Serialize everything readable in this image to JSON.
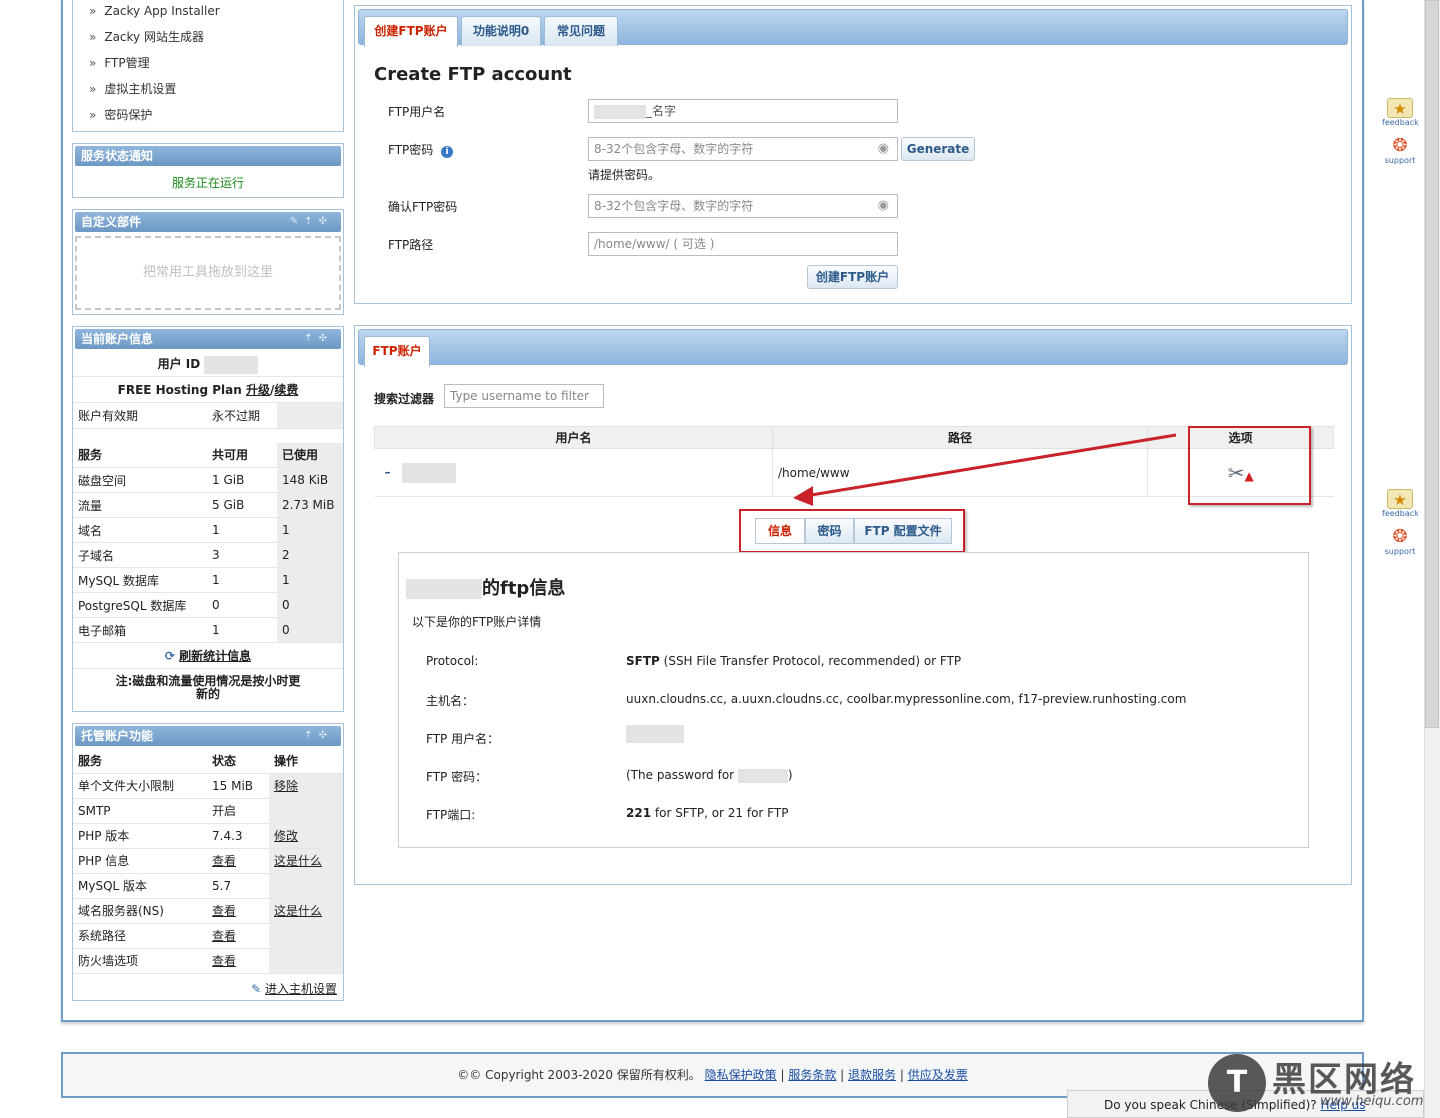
{
  "sidebar_menu": [
    "Zacky App Installer",
    "Zacky 网站生成器",
    "FTP管理",
    "虚拟主机设置",
    "密码保护"
  ],
  "menu_chevron": "»",
  "service_status": {
    "title": "服务状态通知",
    "text": "服务正在运行"
  },
  "custom_widgets": {
    "title": "自定义部件",
    "placeholder": "把常用工具拖放到这里"
  },
  "account_info": {
    "title": "当前账户信息",
    "user_id_label": "用户 ID",
    "plan_prefix": "FREE Hosting Plan ",
    "plan_upgrade": "升级",
    "plan_sep": "/",
    "plan_renew": "续费",
    "validity_label": "账户有效期",
    "validity_value": "永不过期",
    "headers": [
      "服务",
      "共可用",
      "已使用"
    ],
    "rows": [
      [
        "磁盘空间",
        "1 GiB",
        "148 KiB"
      ],
      [
        "流量",
        "5 GiB",
        "2.73 MiB"
      ],
      [
        "域名",
        "1",
        "1"
      ],
      [
        "子域名",
        "3",
        "2"
      ],
      [
        "MySQL 数据库",
        "1",
        "1"
      ],
      [
        "PostgreSQL 数据库",
        "0",
        "0"
      ],
      [
        "电子邮箱",
        "1",
        "0"
      ]
    ],
    "refresh_label": "刷新统计信息",
    "note": "注:磁盘和流量使用情况是按小时更新的"
  },
  "hosting_features": {
    "title": "托管账户功能",
    "headers": [
      "服务",
      "状态",
      "操作"
    ],
    "rows": [
      [
        "单个文件大小限制",
        "15 MiB",
        "移除"
      ],
      [
        "SMTP",
        "开启",
        ""
      ],
      [
        "PHP 版本",
        "7.4.3",
        "修改"
      ],
      [
        "PHP 信息",
        "查看",
        "这是什么"
      ],
      [
        "MySQL 版本",
        "5.7",
        ""
      ],
      [
        "域名服务器(NS)",
        "查看",
        "这是什么"
      ],
      [
        "系统路径",
        "查看",
        ""
      ],
      [
        "防火墙选项",
        "查看",
        ""
      ]
    ],
    "enter_settings": "进入主机设置"
  },
  "create_panel": {
    "tabs": [
      "创建FTP账户",
      "功能说明0",
      "常见问题"
    ],
    "title": "Create FTP account",
    "username_label": "FTP用户名",
    "username_suffix": "_名字",
    "password_label": "FTP密码",
    "password_placeholder": "8-32个包含字母、数字的字符",
    "generate_button": "Generate",
    "password_hint": "请提供密码。",
    "confirm_label": "确认FTP密码",
    "confirm_placeholder": "8-32个包含字母、数字的字符",
    "path_label": "FTP路径",
    "path_placeholder": "/home/www/ ( 可选 )",
    "submit_button": "创建FTP账户"
  },
  "accounts_panel": {
    "tab": "FTP账户",
    "filter_label": "搜索过滤器",
    "filter_placeholder": "Type username to filter",
    "columns": [
      "用户名",
      "路径",
      "选项"
    ],
    "row": {
      "toggle": "–",
      "path": "/home/www"
    },
    "subtabs": [
      "信息",
      "密码",
      "FTP 配置文件"
    ],
    "info_title": "的ftp信息",
    "info_intro": "以下是你的FTP账户详情",
    "details": [
      {
        "label": "Protocol:",
        "bold": "SFTP",
        "value": " (SSH File Transfer Protocol, recommended) or FTP"
      },
      {
        "label": "主机名：",
        "bold": "",
        "value": "uuxn.cloudns.cc, a.uuxn.cloudns.cc, coolbar.mypressonline.com, f17-preview.runhosting.com"
      },
      {
        "label": "FTP 用户名：",
        "bold": "",
        "value": ""
      },
      {
        "label": "FTP 密码：",
        "bold": "",
        "value": "(The password for "
      },
      {
        "label": "FTP端口:",
        "bold": "221",
        "value": " for SFTP, or 21 for FTP"
      }
    ],
    "password_close": ")"
  },
  "side_widgets": [
    "feedback",
    "support",
    "feedback",
    "support"
  ],
  "footer": {
    "copyright": "©© Copyright  2003-2020 保留所有权利。",
    "links": [
      "隐私保护政策",
      "服务条款",
      "退款服务",
      "供应及发票"
    ],
    "sep": " | "
  },
  "translate_bar": {
    "text": "Do you speak ",
    "lang": "Chinese (Simplified)",
    "q": "?",
    "link": "Help us translate!"
  },
  "watermark": {
    "text": "黑区网络",
    "url": "www.heiqu.com"
  }
}
